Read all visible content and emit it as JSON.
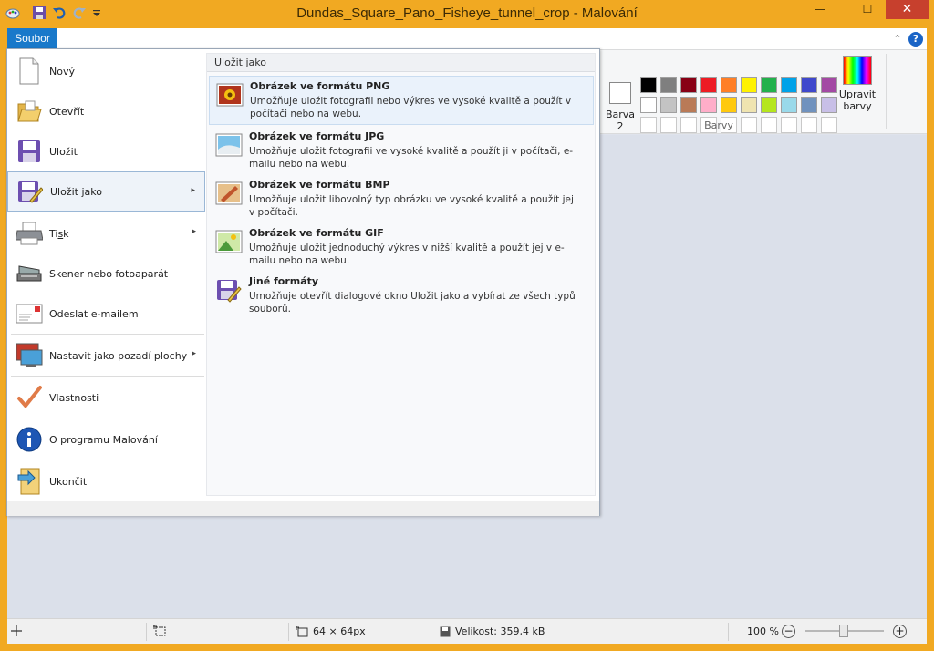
{
  "window": {
    "title": "Dundas_Square_Pano_Fisheye_tunnel_crop - Malování",
    "minimize": "—",
    "maximize": "☐",
    "close": "✕"
  },
  "tabs": {
    "file": "Soubor"
  },
  "help": {
    "collapse": "⌃",
    "help": "?"
  },
  "ribbon": {
    "color2_label_line1": "Barva",
    "color2_label_line2": "2",
    "edit_colors_line1": "Upravit",
    "edit_colors_line2": "barvy",
    "group_label": "Barvy",
    "palette_row1": [
      "#000000",
      "#7f7f7f",
      "#880015",
      "#ed1c24",
      "#ff7f27",
      "#fff200",
      "#22b14c",
      "#00a2e8",
      "#3f48cc",
      "#a349a4"
    ],
    "palette_row2": [
      "#ffffff",
      "#c3c3c3",
      "#b97a57",
      "#ffaec9",
      "#ffc90e",
      "#efe4b0",
      "#b5e61d",
      "#99d9ea",
      "#7092be",
      "#c8bfe7"
    ]
  },
  "menu": {
    "items": [
      {
        "label": "Nový",
        "icon": "new-document-icon"
      },
      {
        "label": "Otevřít",
        "icon": "open-folder-icon"
      },
      {
        "label": "Uložit",
        "icon": "save-disk-icon"
      },
      {
        "label": "Uložit jako",
        "icon": "save-as-icon",
        "arrow": "▸"
      },
      {
        "label": "Tisk",
        "icon": "printer-icon",
        "arrow": "▸"
      },
      {
        "label": "Skener nebo fotoaparát",
        "icon": "scanner-icon"
      },
      {
        "label": "Odeslat e-mailem",
        "icon": "email-icon"
      },
      {
        "label": "Nastavit jako pozadí plochy",
        "icon": "desktop-background-icon",
        "arrow": "▸"
      },
      {
        "label": "Vlastnosti",
        "icon": "checkmark-icon"
      },
      {
        "label": "O programu Malování",
        "icon": "info-icon"
      },
      {
        "label": "Ukončit",
        "icon": "exit-icon"
      }
    ],
    "submenu_header": "Uložit jako",
    "submenu": [
      {
        "title": "Obrázek ve formátu PNG",
        "desc": "Umožňuje uložit fotografii nebo výkres ve vysoké kvalitě a použít v počítači nebo na webu.",
        "icon": "png-image-icon"
      },
      {
        "title": "Obrázek ve formátu JPG",
        "desc": "Umožňuje uložit fotografii ve vysoké kvalitě a použít ji v počítači, e-mailu nebo na webu.",
        "icon": "jpg-image-icon"
      },
      {
        "title": "Obrázek ve formátu BMP",
        "desc": "Umožňuje uložit libovolný typ obrázku ve vysoké kvalitě a použít jej v počítači.",
        "icon": "bmp-image-icon"
      },
      {
        "title": "Obrázek ve formátu GIF",
        "desc": "Umožňuje uložit jednoduchý výkres v nižší kvalitě a použít jej v e-mailu nebo na webu.",
        "icon": "gif-image-icon"
      },
      {
        "title": "Jiné formáty",
        "desc": "Umožňuje otevřít dialogové okno Uložit jako a vybírat ze všech typů souborů.",
        "icon": "other-formats-icon"
      }
    ]
  },
  "status": {
    "dimensions": "64 × 64px",
    "size": "Velikost: 359,4 kB",
    "zoom": "100 %",
    "zoom_level": 1.0,
    "zoom_out": "−",
    "zoom_in": "+"
  }
}
